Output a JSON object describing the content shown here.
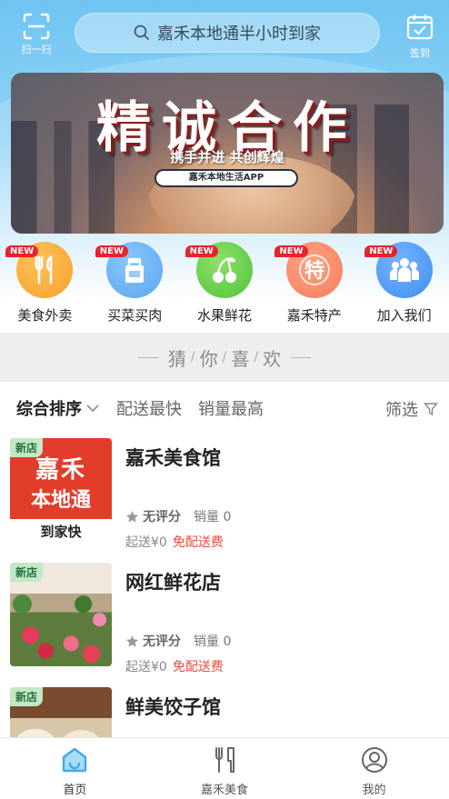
{
  "header": {
    "scan_label": "扫一扫",
    "search_placeholder": "嘉禾本地通半小时到家",
    "checkin_label": "签到"
  },
  "banner": {
    "title": "精诚合作",
    "subtitle": "携手并进  共创辉煌",
    "pill": "嘉禾本地生活APP"
  },
  "categories": [
    {
      "label": "美食外卖",
      "badge": "NEW",
      "icon": "fork-knife-icon",
      "color": "#f6a12b"
    },
    {
      "label": "买菜买肉",
      "badge": "NEW",
      "icon": "grocery-bag-icon",
      "color": "#5aa6ef"
    },
    {
      "label": "水果鲜花",
      "badge": "NEW",
      "icon": "cherry-icon",
      "color": "#52c33a"
    },
    {
      "label": "嘉禾特产",
      "badge": "NEW",
      "icon": "specialty-icon",
      "color": "#f57f5b"
    },
    {
      "label": "加入我们",
      "badge": "NEW",
      "icon": "people-icon",
      "color": "#3d8ef0"
    }
  ],
  "guess": {
    "chars": [
      "猜",
      "你",
      "喜",
      "欢"
    ]
  },
  "sort": {
    "options": [
      "综合排序",
      "配送最快",
      "销量最高"
    ],
    "filter": "筛选"
  },
  "shops": [
    {
      "name": "嘉禾美食馆",
      "badge": "新店",
      "rating": "无评分",
      "sales": "销量 0",
      "min_order": "起送¥0",
      "delivery": "免配送费",
      "thumb_text": [
        "嘉禾",
        "本地通",
        "到家快"
      ]
    },
    {
      "name": "网红鲜花店",
      "badge": "新店",
      "rating": "无评分",
      "sales": "销量 0",
      "min_order": "起送¥0",
      "delivery": "免配送费"
    },
    {
      "name": "鲜美饺子馆",
      "badge": "新店"
    }
  ],
  "tabbar": {
    "items": [
      {
        "label": "首页",
        "icon": "home-icon",
        "active": true
      },
      {
        "label": "嘉禾美食",
        "icon": "utensils-icon",
        "active": false
      },
      {
        "label": "我的",
        "icon": "user-icon",
        "active": false
      }
    ]
  },
  "colors": {
    "accent": "#44a8ea",
    "new_badge": "#e8232e",
    "free_delivery": "#ef4b3b",
    "new_shop_badge": "#c2e8c6"
  }
}
